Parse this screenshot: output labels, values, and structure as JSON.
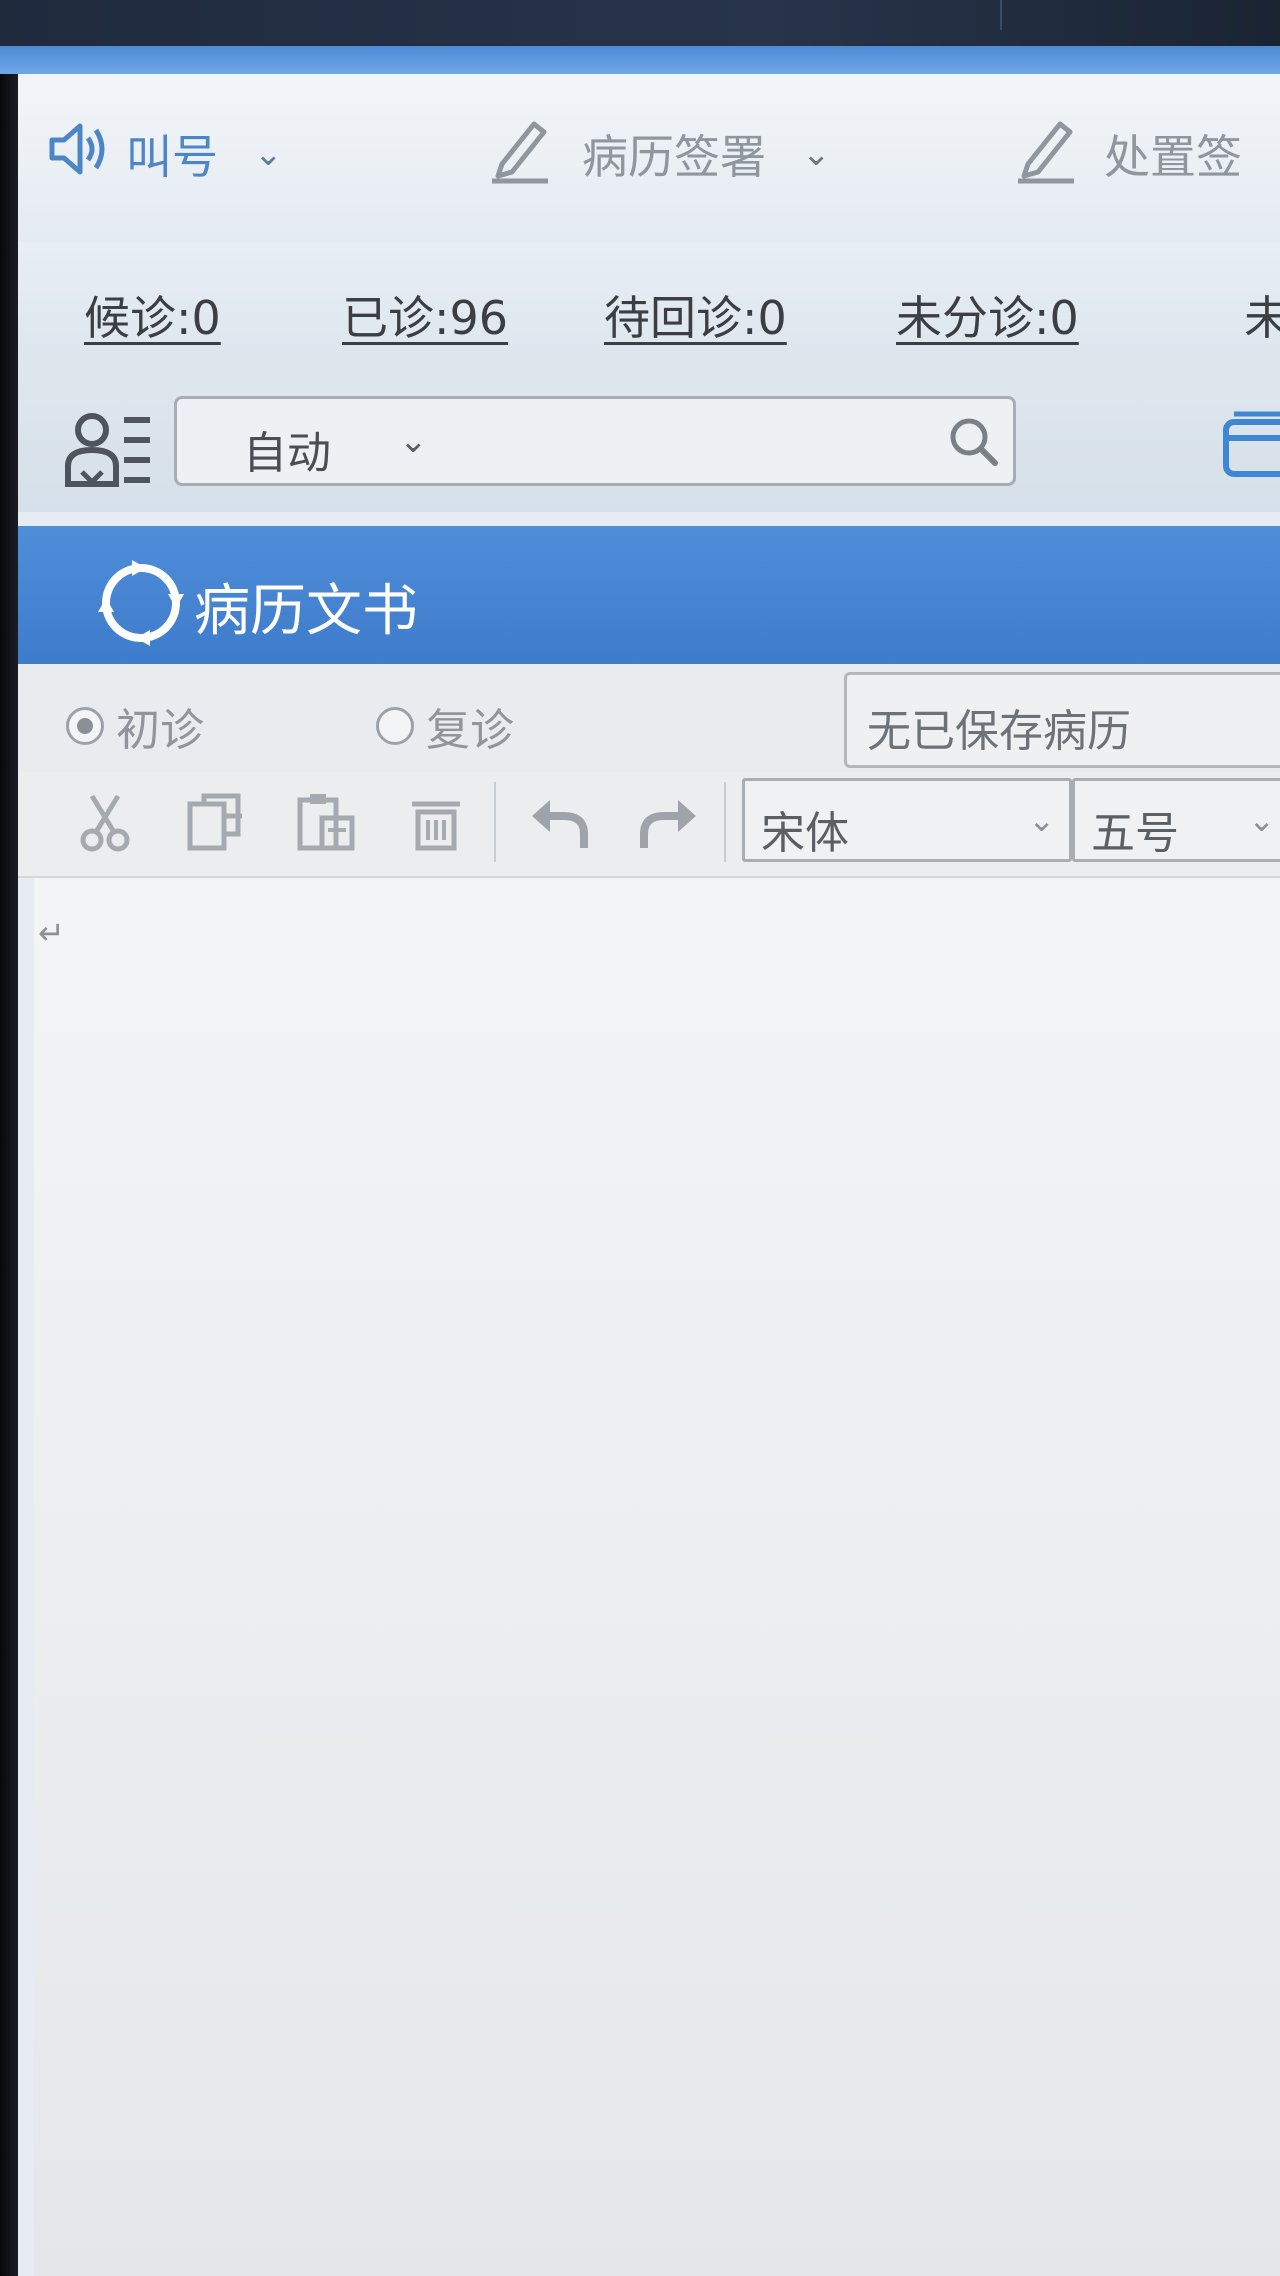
{
  "toolbar": {
    "call_number_label": "叫号",
    "record_sign_label": "病历签署",
    "treatment_sign_label": "处置签"
  },
  "counters": {
    "waiting": "候诊:0",
    "seen": "已诊:96",
    "pending_return": "待回诊:0",
    "unassigned": "未分诊:0",
    "clipped": "未"
  },
  "selector": {
    "mode_value": "自动"
  },
  "section": {
    "title": "病历文书"
  },
  "visit_type": {
    "options": [
      {
        "label": "初诊",
        "selected": true
      },
      {
        "label": "复诊",
        "selected": false
      }
    ],
    "saved_records_value": "无已保存病历"
  },
  "editor": {
    "font_family_value": "宋体",
    "font_size_value": "五号",
    "paragraph_mark": "↵"
  },
  "colors": {
    "accent": "#4f8ed9",
    "app_background": "#e6ecf2"
  }
}
